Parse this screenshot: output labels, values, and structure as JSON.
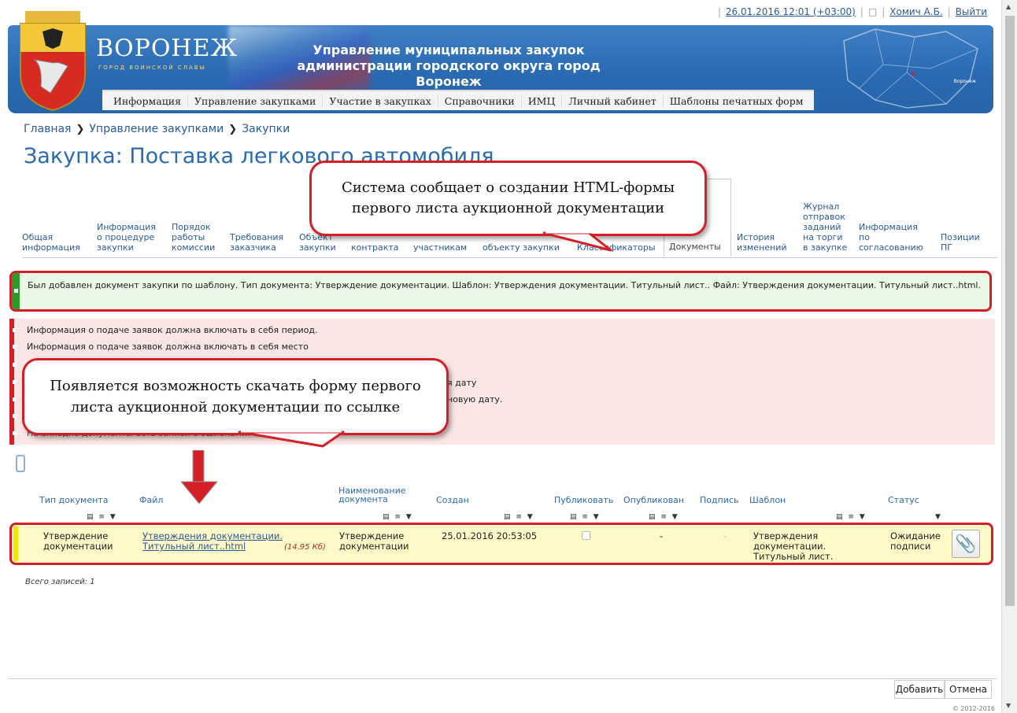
{
  "topbar": {
    "datetime": "26.01.2016 12:01 (+03:00)",
    "user": "Хомич А.Б.",
    "logout": "Выйти"
  },
  "header": {
    "city": "ВОРОНЕЖ",
    "city_tagline": "ГОРОД ВОИНСКОЙ СЛАВЫ",
    "department_line1": "Управление муниципальных закупок",
    "department_line2": "администрации городского округа город Воронеж",
    "map_label": "Воронеж"
  },
  "menu": [
    "Информация",
    "Управление закупками",
    "Участие в закупках",
    "Справочники",
    "ИМЦ",
    "Личный кабинет",
    "Шаблоны печатных форм"
  ],
  "breadcrumb": {
    "home": "Главная",
    "section": "Управление закупками",
    "current": "Закупки"
  },
  "page_title": "Закупка: Поставка легкового автомобиля",
  "tabs": [
    "Общая информация",
    "Информация о процедуре закупки",
    "Порядок работы комиссии",
    "Требования заказчика",
    "Объект закупки",
    "контракта",
    "участникам",
    "объекту закупки",
    "Классификаторы",
    "Документы",
    "История изменений",
    "Журнал отправок заданий на торги в закупке",
    "Информация по согласованию",
    "Позиции ПГ"
  ],
  "success_message": "Был добавлен документ закупки по шаблону. Тип документа: Утверждение документации. Шаблон: Утверждения документации. Титульный лист.. Файл: Утверждения документации. Титульный лист..html.",
  "errors": [
    "Информация о подаче заявок должна включать в себя период.",
    "Информация о подаче заявок должна включать в себя место",
    "я дату",
    "новую дату.",
    "На вкладке документы есть записи с ошибками."
  ],
  "table": {
    "headers": {
      "doc_type": "Тип документа",
      "file": "Файл",
      "doc_name": "Наименование документа",
      "created": "Создан",
      "publish": "Публиковать",
      "published": "Опубликован",
      "signature": "Подпись",
      "template": "Шаблон",
      "status": "Статус"
    },
    "row": {
      "doc_type": "Утверждение документации",
      "file": "Утверждения документации. Титульный лист..html",
      "size": "(14.95 Кб)",
      "doc_name": "Утверждение документации",
      "created": "25.01.2016 20:53:05",
      "published": "-",
      "signature": "-",
      "template": "Утверждения документации. Титульный лист.",
      "status": "Ожидание подписи"
    },
    "total": "Всего записей: 1"
  },
  "buttons": {
    "add": "Добавить",
    "cancel": "Отмена"
  },
  "copyright": "© 2012-2016",
  "callouts": {
    "top": "Система сообщает о создании HTML-формы первого листа аукционной документации",
    "middle": "Появляется возможность скачать форму первого листа аукционной документации по ссылке"
  },
  "colors": {
    "accent_red": "#d51f27",
    "header_blue": "#2a6ab2",
    "success_green": "#2a9b2a",
    "row_yellow": "#fff9c8"
  }
}
